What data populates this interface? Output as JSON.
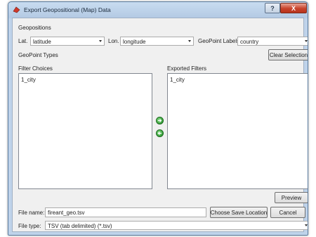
{
  "window": {
    "title": "Export Geopositional (Map) Data",
    "help_label": "?",
    "close_label": "X"
  },
  "geopositions": {
    "heading": "Geopositions",
    "lat_label": "Lat.",
    "lat_value": "latitude",
    "lon_label": "Lon.",
    "lon_value": "longitude",
    "labels_label": "GeoPoint Labels",
    "labels_value": "country"
  },
  "types": {
    "heading": "GeoPoint Types",
    "clear_label": "Clear Selection"
  },
  "filters": {
    "choices_heading": "Filter Choices",
    "choices": [
      "1_city"
    ],
    "exported_heading": "Exported Filters",
    "exported": [
      "1_city"
    ]
  },
  "preview_label": "Preview",
  "file": {
    "name_label": "File name:",
    "name_value": "fireant_geo.tsv",
    "choose_label": "Choose Save Location",
    "cancel_label": "Cancel",
    "type_label": "File type:",
    "type_value": "TSV (tab delimited) (*.tsv)"
  },
  "colors": {
    "accent": "#1f8a22",
    "title_bar": "#c8dcf0"
  }
}
